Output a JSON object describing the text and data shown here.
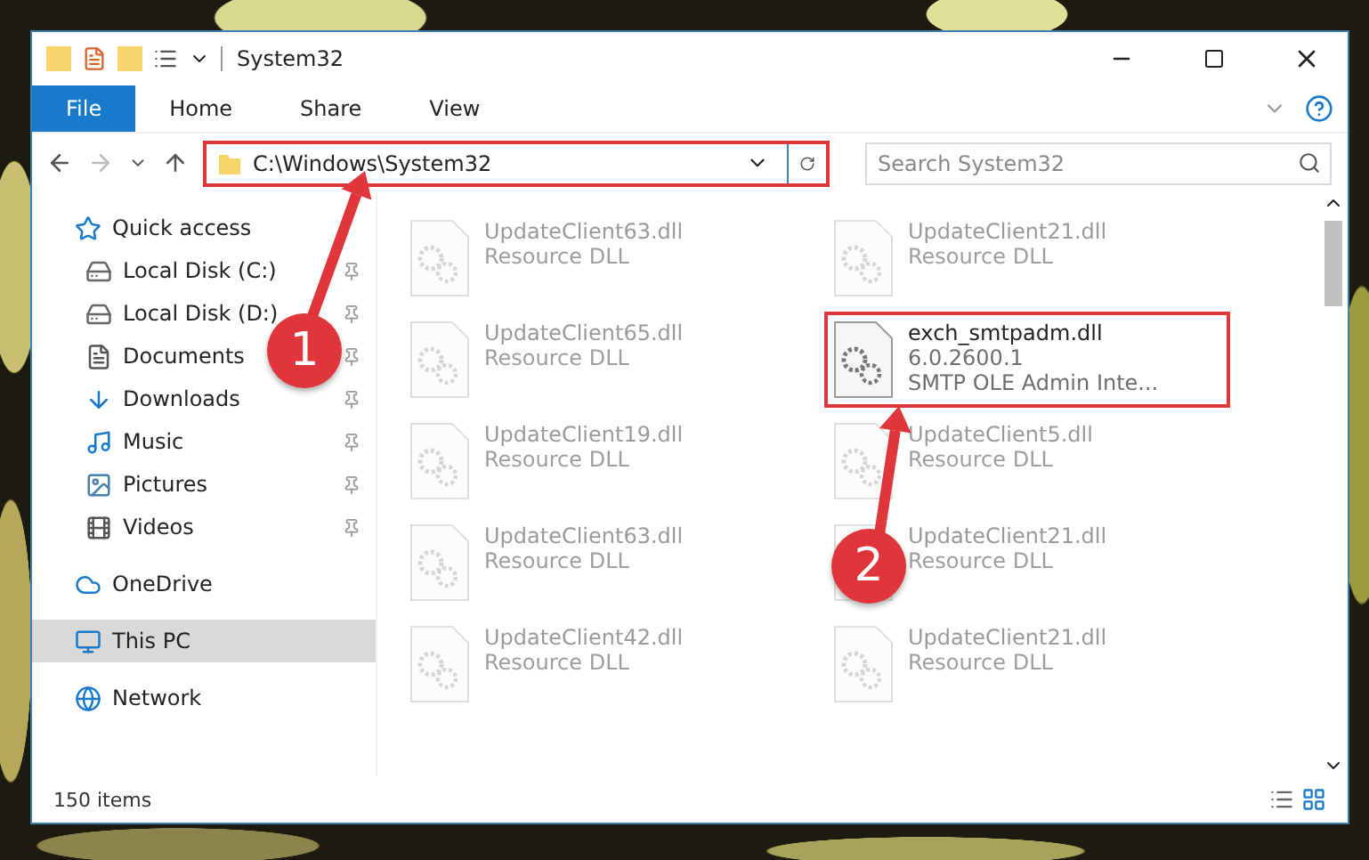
{
  "window": {
    "title": "System32"
  },
  "ribbon": {
    "tabs": [
      {
        "label": "File",
        "selected": true
      },
      {
        "label": "Home",
        "selected": false
      },
      {
        "label": "Share",
        "selected": false
      },
      {
        "label": "View",
        "selected": false
      }
    ]
  },
  "address": {
    "path": "C:\\Windows\\System32",
    "highlighted": true
  },
  "search": {
    "placeholder": "Search System32"
  },
  "sidebar": {
    "items": [
      {
        "label": "Quick access",
        "selected": false,
        "children": [
          {
            "label": "Local Disk (C:)",
            "pinned": true,
            "selected": false
          },
          {
            "label": "Local Disk (D:)",
            "pinned": true,
            "selected": false
          },
          {
            "label": "Documents",
            "pinned": true,
            "selected": false
          },
          {
            "label": "Downloads",
            "pinned": true,
            "selected": false
          },
          {
            "label": "Music",
            "pinned": true,
            "selected": false
          },
          {
            "label": "Pictures",
            "pinned": true,
            "selected": false
          },
          {
            "label": "Videos",
            "pinned": true,
            "selected": false
          }
        ]
      },
      {
        "label": "OneDrive",
        "selected": false
      },
      {
        "label": "This PC",
        "selected": true
      },
      {
        "label": "Network",
        "selected": false
      }
    ]
  },
  "files": [
    {
      "name": "UpdateClient63.dll",
      "lines": [
        "Resource DLL"
      ],
      "faded": true,
      "highlighted": false
    },
    {
      "name": "UpdateClient21.dll",
      "lines": [
        "Resource DLL"
      ],
      "faded": true,
      "highlighted": false
    },
    {
      "name": "UpdateClient65.dll",
      "lines": [
        "Resource DLL"
      ],
      "faded": true,
      "highlighted": false
    },
    {
      "name": "exch_smtpadm.dll",
      "lines": [
        "6.0.2600.1",
        "SMTP OLE Admin Inte..."
      ],
      "faded": false,
      "highlighted": true
    },
    {
      "name": "UpdateClient19.dll",
      "lines": [
        "Resource DLL"
      ],
      "faded": true,
      "highlighted": false
    },
    {
      "name": "UpdateClient5.dll",
      "lines": [
        "Resource DLL"
      ],
      "faded": true,
      "highlighted": false
    },
    {
      "name": "UpdateClient63.dll",
      "lines": [
        "Resource DLL"
      ],
      "faded": true,
      "highlighted": false
    },
    {
      "name": "UpdateClient21.dll",
      "lines": [
        "Resource DLL"
      ],
      "faded": true,
      "highlighted": false
    },
    {
      "name": "UpdateClient42.dll",
      "lines": [
        "Resource DLL"
      ],
      "faded": true,
      "highlighted": false
    },
    {
      "name": "UpdateClient21.dll",
      "lines": [
        "Resource DLL"
      ],
      "faded": true,
      "highlighted": false
    }
  ],
  "status_bar": {
    "count": "150 items"
  },
  "annotations": [
    {
      "number": "1"
    },
    {
      "number": "2"
    }
  ]
}
